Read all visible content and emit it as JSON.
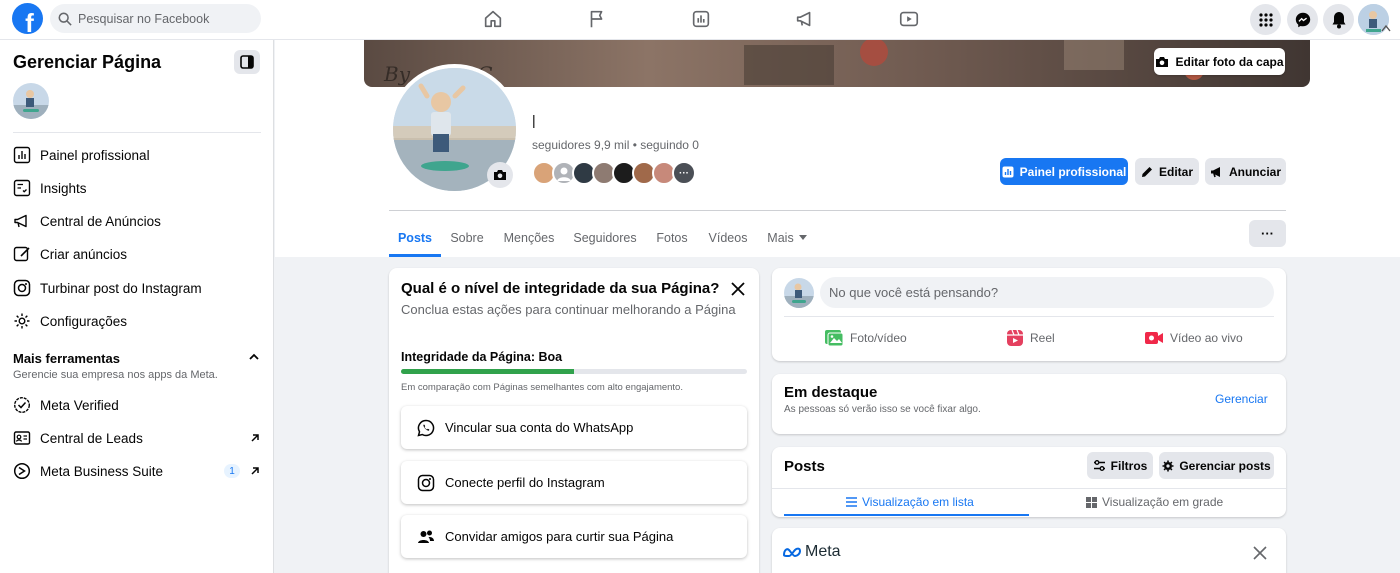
{
  "topbar": {
    "logo_letter": "f",
    "search_placeholder": "Pesquisar no Facebook",
    "nav_icons": [
      "home-icon",
      "flag-icon",
      "insights-icon",
      "megaphone-icon",
      "video-icon"
    ],
    "right_icons": [
      "menu-grid-icon",
      "messenger-icon",
      "notifications-icon",
      "account-avatar"
    ]
  },
  "sidebar": {
    "title": "Gerenciar Página",
    "items": [
      {
        "label": "Painel profissional",
        "icon": "dashboard-icon"
      },
      {
        "label": "Insights",
        "icon": "insights-icon"
      },
      {
        "label": "Central de Anúncios",
        "icon": "megaphone-icon"
      },
      {
        "label": "Criar anúncios",
        "icon": "pencil-icon"
      },
      {
        "label": "Turbinar post do Instagram",
        "icon": "instagram-icon"
      },
      {
        "label": "Configurações",
        "icon": "gear-icon"
      }
    ],
    "more_tools": {
      "title": "Mais ferramentas",
      "subtitle": "Gerencie sua empresa nos apps da Meta.",
      "items": [
        {
          "label": "Meta Verified",
          "icon": "verified-icon"
        },
        {
          "label": "Central de Leads",
          "icon": "leads-icon"
        },
        {
          "label": "Meta Business Suite",
          "icon": "business-suite-icon",
          "badge": "1"
        }
      ]
    }
  },
  "header": {
    "cover_text": "By ...ous.G",
    "edit_cover_label": "Editar foto da capa",
    "page_name": "|",
    "followers_text": "seguidores 9,9 mil • seguindo 0",
    "buttons": {
      "dashboard": "Painel profissional",
      "edit": "Editar",
      "advertise": "Anunciar"
    },
    "tabs": [
      "Posts",
      "Sobre",
      "Menções",
      "Seguidores",
      "Fotos",
      "Vídeos",
      "Mais"
    ],
    "active_tab": "Posts",
    "more_button": "···"
  },
  "integrity": {
    "title": "Qual é o nível de integridade da sua Página?",
    "subtitle": "Conclua estas ações para continuar melhorando a Página",
    "status_label": "Integridade da Página: Boa",
    "progress": 0.5,
    "comparison": "Em comparação com Páginas semelhantes com alto engajamento.",
    "actions": [
      {
        "label": "Vincular sua conta do WhatsApp",
        "icon": "whatsapp-icon"
      },
      {
        "label": "Conecte perfil do Instagram",
        "icon": "instagram-icon"
      },
      {
        "label": "Convidar amigos para curtir sua Página",
        "icon": "friends-icon"
      }
    ]
  },
  "composer": {
    "placeholder": "No que você está pensando?",
    "actions": [
      "Foto/vídeo",
      "Reel",
      "Vídeo ao vivo"
    ]
  },
  "featured": {
    "title": "Em destaque",
    "subtitle": "As pessoas só verão isso se você fixar algo.",
    "manage": "Gerenciar"
  },
  "posts": {
    "title": "Posts",
    "filters": "Filtros",
    "manage": "Gerenciar posts",
    "list_view": "Visualização em lista",
    "grid_view": "Visualização em grade"
  },
  "meta_card": {
    "logo_text": "Meta"
  },
  "colors": {
    "brand": "#1877f2",
    "progress": "#31a24c",
    "bg": "#f0f2f5"
  }
}
